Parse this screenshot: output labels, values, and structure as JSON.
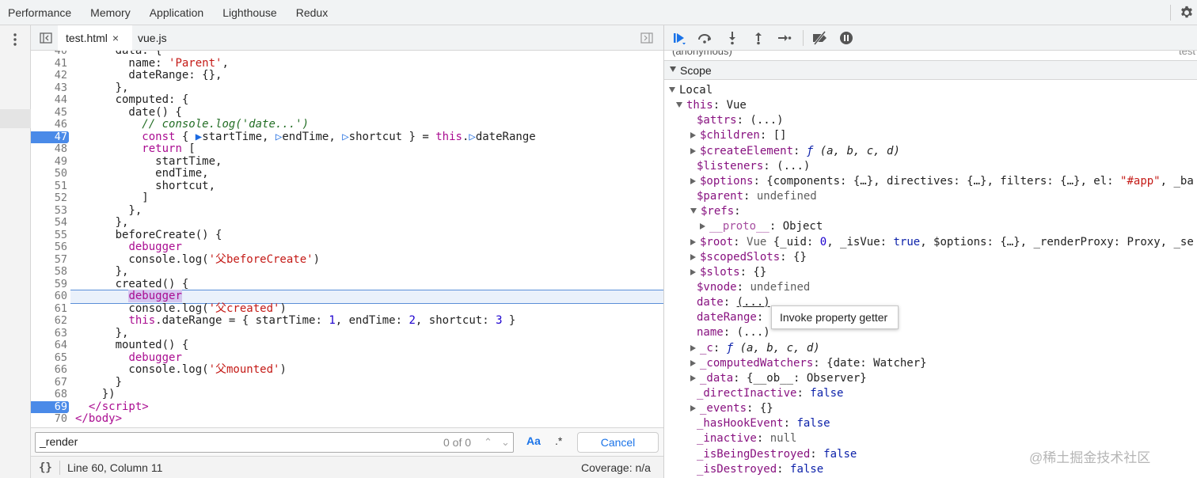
{
  "top_tabs": [
    "Performance",
    "Memory",
    "Application",
    "Lighthouse",
    "Redux"
  ],
  "file_tabs": [
    {
      "label": "test.html",
      "close": "×"
    },
    {
      "label": "vue.js"
    }
  ],
  "code_lines": [
    {
      "n": "40",
      "html": "      <span>data: {</span>"
    },
    {
      "n": "41",
      "html": "        name: <span class=\"str\">'Parent'</span>,"
    },
    {
      "n": "42",
      "html": "        dateRange: {},"
    },
    {
      "n": "43",
      "html": "      },"
    },
    {
      "n": "44",
      "html": "      computed: {"
    },
    {
      "n": "45",
      "html": "        date() {"
    },
    {
      "n": "46",
      "html": "          <span class=\"cm\">// console.log('date...')</span>"
    },
    {
      "n": "47",
      "bp": true,
      "html": "          <span class=\"kw\">const</span> { <span class=\"inl\">▶</span>startTime, <span class=\"inl\">▷</span>endTime, <span class=\"inl\">▷</span>shortcut } = <span class=\"kw\">this</span>.<span class=\"inl\">▷</span>dateRange"
    },
    {
      "n": "48",
      "html": "          <span class=\"kw\">return</span> ["
    },
    {
      "n": "49",
      "html": "            startTime,"
    },
    {
      "n": "50",
      "html": "            endTime,"
    },
    {
      "n": "51",
      "html": "            shortcut,"
    },
    {
      "n": "52",
      "html": "          ]"
    },
    {
      "n": "53",
      "html": "        },"
    },
    {
      "n": "54",
      "html": "      },"
    },
    {
      "n": "55",
      "html": "      beforeCreate() {"
    },
    {
      "n": "56",
      "html": "        <span class=\"kw\">debugger</span>"
    },
    {
      "n": "57",
      "html": "        console.log(<span class=\"str\">'父beforeCreate'</span>)"
    },
    {
      "n": "58",
      "html": "      },"
    },
    {
      "n": "59",
      "html": "      created() {"
    },
    {
      "n": "60",
      "cur": true,
      "html": "        <span class=\"dbg\">debugger</span>"
    },
    {
      "n": "61",
      "html": "        console.log(<span class=\"str\">'父created'</span>)"
    },
    {
      "n": "62",
      "html": "        <span class=\"kw\">this</span>.dateRange = { startTime: <span class=\"num\">1</span>, endTime: <span class=\"num\">2</span>, shortcut: <span class=\"num\">3</span> }"
    },
    {
      "n": "63",
      "html": "      },"
    },
    {
      "n": "64",
      "html": "      mounted() {"
    },
    {
      "n": "65",
      "html": "        <span class=\"kw\">debugger</span>"
    },
    {
      "n": "66",
      "html": "        console.log(<span class=\"str\">'父mounted'</span>)"
    },
    {
      "n": "67",
      "html": "      }"
    },
    {
      "n": "68",
      "html": "    })"
    },
    {
      "n": "69",
      "bp": true,
      "html": "  <span class=\"kw\">&lt;/script&gt;</span>"
    },
    {
      "n": "70",
      "html": "<span class=\"kw\">&lt;/body&gt;</span>"
    }
  ],
  "search": {
    "value": "_render",
    "count": "0 of 0",
    "match_case": "Aa",
    "regex": ".*",
    "cancel": "Cancel"
  },
  "status": {
    "braces": "{}",
    "position": "Line 60, Column 11",
    "coverage": "Coverage: n/a"
  },
  "callstack_prev": {
    "label": "(anonymous)",
    "file": "test"
  },
  "scope": {
    "header": "Scope"
  },
  "tree": [
    {
      "d": 0,
      "t": "down",
      "html": "<span class=\"pv\">Local</span>"
    },
    {
      "d": 1,
      "t": "down",
      "html": "<span class=\"pk\">this</span>: Vue"
    },
    {
      "d": 2,
      "t": "",
      "html": "<span class=\"pk\">$attrs</span>: (...)"
    },
    {
      "d": 2,
      "t": "right",
      "html": "<span class=\"pk\">$children</span>: []"
    },
    {
      "d": 2,
      "t": "right",
      "html": "<span class=\"pk\">$createElement</span>: <span class=\"pfnf\">ƒ</span> <span class=\"pfn\">(a, b, c, d)</span>"
    },
    {
      "d": 2,
      "t": "",
      "html": "<span class=\"pk\">$listeners</span>: (...)"
    },
    {
      "d": 2,
      "t": "right",
      "html": "<span class=\"pk\">$options</span>: {components: {…}, directives: {…}, filters: {…}, el: <span class=\"pstr\">\"#app\"</span>, _ba"
    },
    {
      "d": 2,
      "t": "",
      "html": "<span class=\"pk\">$parent</span>: <span class=\"pnull\">undefined</span>"
    },
    {
      "d": 2,
      "t": "down",
      "html": "<span class=\"pk\">$refs</span>:"
    },
    {
      "d": 3,
      "t": "right",
      "html": "<span class=\"pkd\">__proto__</span>: Object"
    },
    {
      "d": 2,
      "t": "right",
      "html": "<span class=\"pk\">$root</span>: <span class=\"pnull\">Vue</span> {_uid: <span class=\"pnum\">0</span>, _isVue: <span class=\"pbool\">true</span>, $options: {…}, _renderProxy: Proxy, _se"
    },
    {
      "d": 2,
      "t": "right",
      "html": "<span class=\"pk\">$scopedSlots</span>: {}"
    },
    {
      "d": 2,
      "t": "right",
      "html": "<span class=\"pk\">$slots</span>: {}"
    },
    {
      "d": 2,
      "t": "",
      "html": "<span class=\"pk\">$vnode</span>: <span class=\"pnull\">undefined</span>"
    },
    {
      "d": 2,
      "t": "",
      "html": "<span class=\"pk\">date</span>: <span class=\"getter\">(...)</span>"
    },
    {
      "d": 2,
      "t": "",
      "html": "<span class=\"pk\">dateRange</span>:"
    },
    {
      "d": 2,
      "t": "",
      "html": "<span class=\"pk\">name</span>: (...)"
    },
    {
      "d": 2,
      "t": "right",
      "html": "<span class=\"pk\">_c</span>: <span class=\"pfnf\">ƒ</span> <span class=\"pfn\">(a, b, c, d)</span>"
    },
    {
      "d": 2,
      "t": "right",
      "html": "<span class=\"pk\">_computedWatchers</span>: {date: Watcher}"
    },
    {
      "d": 2,
      "t": "right",
      "html": "<span class=\"pk\">_data</span>: {__ob__: Observer}"
    },
    {
      "d": 2,
      "t": "",
      "html": "<span class=\"pk\">_directInactive</span>: <span class=\"pbool\">false</span>"
    },
    {
      "d": 2,
      "t": "right",
      "html": "<span class=\"pk\">_events</span>: {}"
    },
    {
      "d": 2,
      "t": "",
      "html": "<span class=\"pk\">_hasHookEvent</span>: <span class=\"pbool\">false</span>"
    },
    {
      "d": 2,
      "t": "",
      "html": "<span class=\"pk\">_inactive</span>: <span class=\"pnull\">null</span>"
    },
    {
      "d": 2,
      "t": "",
      "html": "<span class=\"pk\">_isBeingDestroyed</span>: <span class=\"pbool\">false</span>"
    },
    {
      "d": 2,
      "t": "",
      "html": "<span class=\"pk\">_isDestroyed</span>: <span class=\"pbool\">false</span>"
    }
  ],
  "tooltip": "Invoke property getter",
  "watermark": "@稀土掘金技术社区",
  "colors": {
    "breakpoint": "#4a8ae8",
    "accent": "#1a73e8",
    "current_line": "#eaf1fb"
  },
  "icons": [
    "kebab-menu-icon",
    "navigator-toggle-icon",
    "debugger-toggle-icon",
    "resume-icon",
    "step-over-icon",
    "step-into-icon",
    "step-out-icon",
    "step-icon",
    "deactivate-breakpoints-icon",
    "pause-on-exceptions-icon",
    "settings-gear-icon"
  ]
}
